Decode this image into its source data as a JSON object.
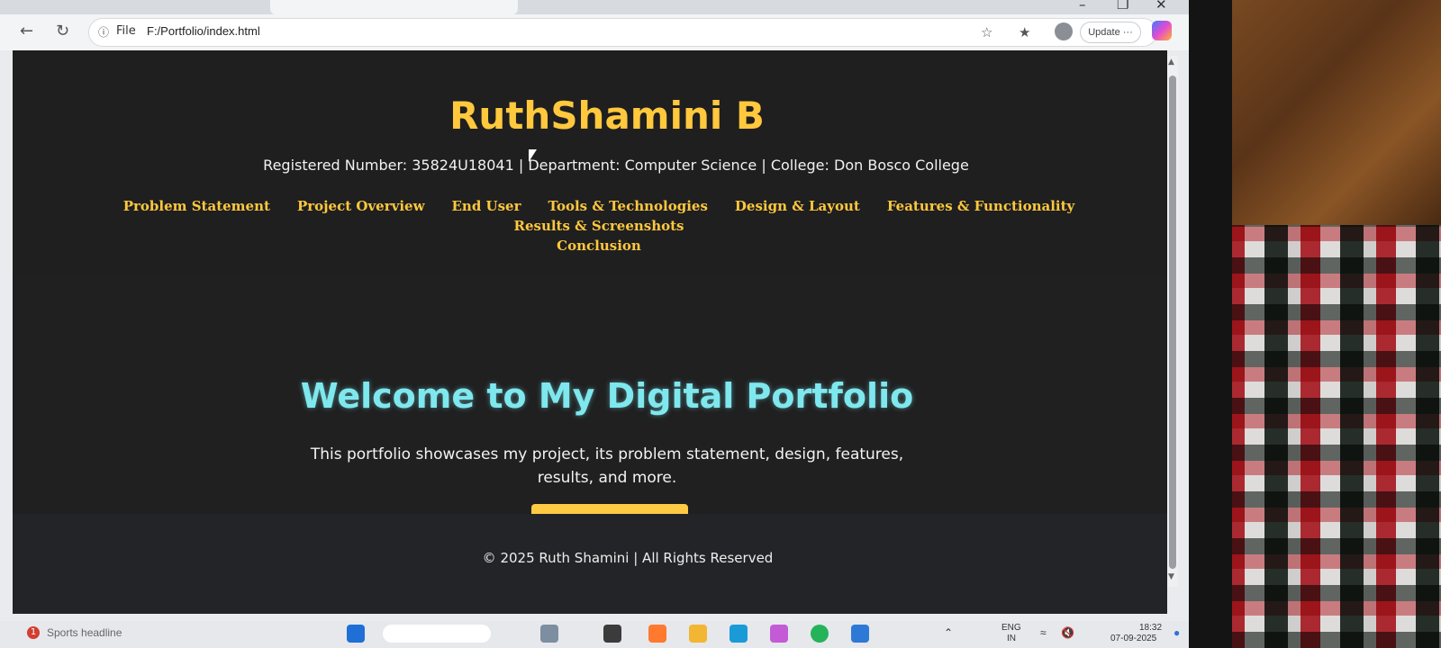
{
  "browser": {
    "address": {
      "info_icon": "info-icon",
      "scheme_label": "File",
      "url": "F:/Portfolio/index.html"
    },
    "update_label": "Update",
    "more_label": "···"
  },
  "page": {
    "title": "RuthShamini B",
    "subtitle": "Registered Number: 35824U18041 | Department: Computer Science | College: Don Bosco College",
    "nav": [
      "Problem Statement",
      "Project Overview",
      "End User",
      "Tools & Technologies",
      "Design & Layout",
      "Features & Functionality",
      "Results & Screenshots",
      "Conclusion"
    ],
    "hero_title": "Welcome to My Digital Portfolio",
    "hero_text": "This portfolio showcases my project, its problem statement, design, features, results, and more.",
    "footer": "© 2025 Ruth Shamini | All Rights Reserved"
  },
  "taskbar": {
    "news_badge": "1",
    "news_text": "Sports headline",
    "lang_top": "ENG",
    "lang_bottom": "IN",
    "time": "18:32",
    "date": "07-09-2025"
  },
  "colors": {
    "title_accent": "#ffc83d",
    "hero_title": "#7ee8ee",
    "page_bg": "#1f1f20"
  }
}
